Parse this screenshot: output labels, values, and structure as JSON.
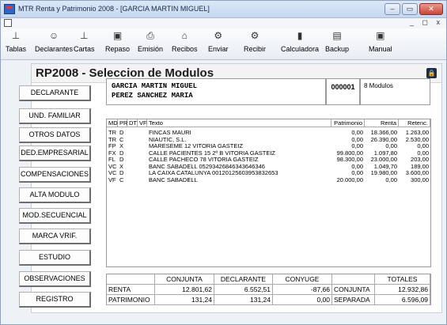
{
  "window": {
    "title": "MTR Renta y Patrimonio 2008 - [GARCIA MARTIN MIGUEL]",
    "min": "–",
    "max": "▭",
    "close": "✕",
    "mdi_controls": "_ ◻ x"
  },
  "toolbar": [
    {
      "label": "Tablas",
      "icon": "table-icon",
      "glyph": "⊥"
    },
    {
      "label": "Declarantes",
      "icon": "people-icon",
      "glyph": "☺"
    },
    {
      "label": "Cartas",
      "icon": "letter-icon",
      "glyph": "⊥"
    },
    {
      "label": "Repaso",
      "icon": "review-icon",
      "glyph": "▣"
    },
    {
      "label": "Emisión",
      "icon": "printer-icon",
      "glyph": "⎙"
    },
    {
      "label": "Recibos",
      "icon": "receipt-icon",
      "glyph": "⌂"
    },
    {
      "label": "Enviar",
      "icon": "send-icon",
      "glyph": "⚙"
    },
    {
      "label": "Recibir",
      "icon": "receive-icon",
      "glyph": "⚙"
    },
    {
      "label": "Calculadora",
      "icon": "calculator-icon",
      "glyph": "▮"
    },
    {
      "label": "Backup",
      "icon": "backup-icon",
      "glyph": "▤"
    },
    {
      "label": "Manual",
      "icon": "manual-icon",
      "glyph": "▣"
    }
  ],
  "panel": {
    "title": "RP2008 -   Seleccion de Modulos",
    "lock_glyph": "🔒"
  },
  "sidebar": [
    "DECLARANTE",
    "UND. FAMILIAR",
    "OTROS DATOS",
    "DED.EMPRESARIAL",
    "COMPENSACIONES",
    "ALTA MODULO",
    "MOD.SECUENCIAL",
    "MARCA VRIF.",
    "ESTUDIO",
    "OBSERVACIONES",
    "REGISTRO"
  ],
  "declarants": {
    "name1": "GARCIA MARTIN MIGUEL",
    "name2": "PEREZ SANCHEZ MARIA",
    "code": "000001",
    "modules": "8 Modulos"
  },
  "grid": {
    "headers": [
      "MD",
      "PR",
      "DT",
      "VF",
      "Texto",
      "Patrimonio",
      "Renta",
      "Retenc."
    ],
    "rows": [
      {
        "md": "TR",
        "pr": "D",
        "dt": "",
        "vf": "",
        "texto": "FINCAS MAURI",
        "patrimonio": "0,00",
        "renta": "18.366,00",
        "retenc": "1.263,00"
      },
      {
        "md": "TR",
        "pr": "C",
        "dt": "",
        "vf": "",
        "texto": "NIAUTIC, S.L.",
        "patrimonio": "0,00",
        "renta": "26.390,00",
        "retenc": "2.530,00"
      },
      {
        "md": "FP",
        "pr": "X",
        "dt": "",
        "vf": "",
        "texto": "MARESEME 12 VITORIA GASTEIZ",
        "patrimonio": "0,00",
        "renta": "0,00",
        "retenc": "0,00"
      },
      {
        "md": "FX",
        "pr": "D",
        "dt": "",
        "vf": "",
        "texto": "CALLE PACIENTES 15 2º B VITORIA GASTEIZ",
        "patrimonio": "99.800,00",
        "renta": "1.097,80",
        "retenc": "0,00"
      },
      {
        "md": "FL",
        "pr": "D",
        "dt": "",
        "vf": "",
        "texto": "CALLE PACHECO 78 VITORIA GASTEIZ",
        "patrimonio": "98.300,00",
        "renta": "23.000,00",
        "retenc": "203,00"
      },
      {
        "md": "VC",
        "pr": "X",
        "dt": "",
        "vf": "",
        "texto": "BANC SABADELL 05293426846343646346",
        "patrimonio": "0,00",
        "renta": "1.049,70",
        "retenc": "189,00"
      },
      {
        "md": "VC",
        "pr": "D",
        "dt": "",
        "vf": "",
        "texto": "LA CAIXA CATALUNYA 00120125603953832653",
        "patrimonio": "0,00",
        "renta": "19.980,00",
        "retenc": "3.600,00"
      },
      {
        "md": "VF",
        "pr": "C",
        "dt": "",
        "vf": "",
        "texto": "BANC SABADELL",
        "patrimonio": "20.000,00",
        "renta": "0,00",
        "retenc": "300,00"
      }
    ]
  },
  "totals": {
    "headers": [
      "",
      "CONJUNTA",
      "DECLARANTE",
      "CONYUGE",
      "",
      "TOTALES"
    ],
    "renta": {
      "label": "RENTA",
      "conjunta": "12.801,62",
      "declarante": "6.552,51",
      "conyuge": "-87,66",
      "tipo": "CONJUNTA",
      "total": "12.932,86"
    },
    "patrimonio": {
      "label": "PATRIMONIO",
      "conjunta": "131,24",
      "declarante": "131,24",
      "conyuge": "0,00",
      "tipo": "SEPARADA",
      "total": "6.596,09"
    }
  }
}
